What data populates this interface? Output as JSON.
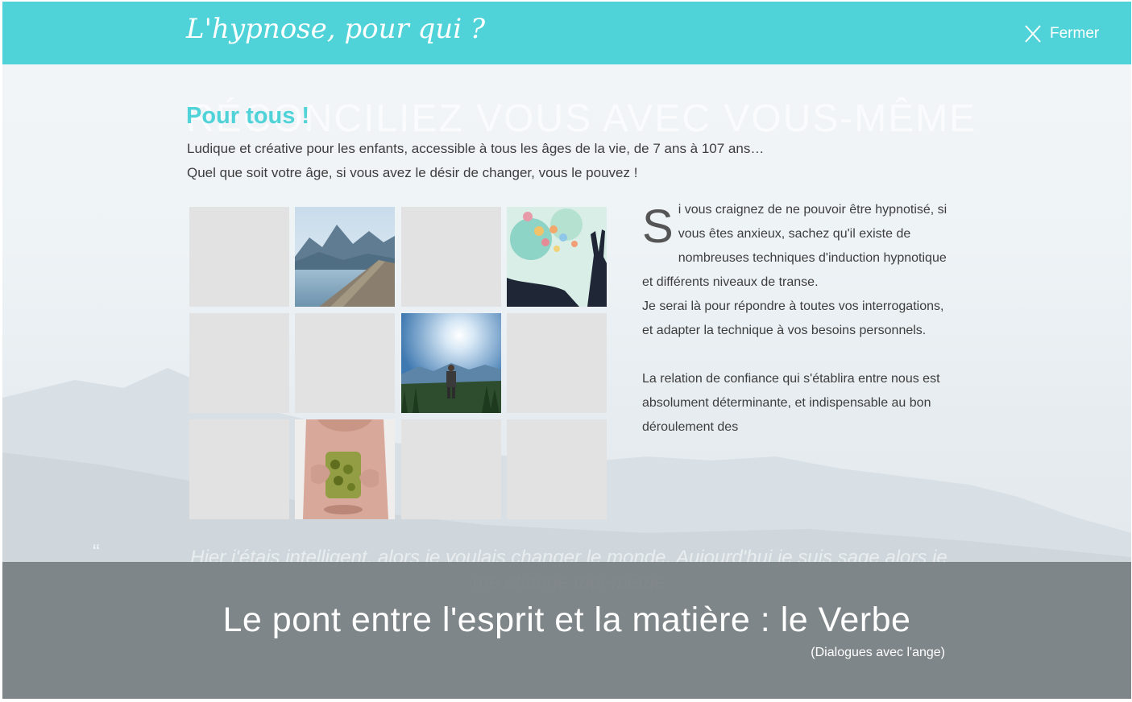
{
  "header": {
    "title": "L'hypnose, pour qui ?",
    "close_label": "Fermer",
    "accent_color": "#4fd3d8"
  },
  "background": {
    "heading": "RÉCONCILIEZ VOUS AVEC VOUS-MÊME",
    "quote": "Hier j'étais intelligent, alors je voulais changer le monde. Aujourd'hui je suis sage alors je me change moi-même"
  },
  "main": {
    "section_title": "Pour tous !",
    "intro_line_1": "Ludique et créative pour les enfants, accessible à tous les âges de la vie, de 7 ans à 107 ans…",
    "intro_line_2": "Quel que soit votre âge, si vous avez le désir de changer, vous le pouvez !",
    "gallery": [
      {
        "image": "blank"
      },
      {
        "image": "lake-pier-photo"
      },
      {
        "image": "blank"
      },
      {
        "image": "balloons-hands-photo"
      },
      {
        "image": "blank"
      },
      {
        "image": "blank"
      },
      {
        "image": "hiker-sun-mountains-photo"
      },
      {
        "image": "blank"
      },
      {
        "image": "blank"
      },
      {
        "image": "man-holding-jar-photo"
      },
      {
        "image": "blank"
      },
      {
        "image": "blank"
      }
    ],
    "drop_cap": "S",
    "paragraph_1_rest": "i vous craignez de ne pouvoir être hypnotisé, si vous êtes anxieux, sachez qu'il existe de nombreuses techniques d'induction hypnotique et différents niveaux de transe.",
    "paragraph_2": "Je serai là pour répondre à toutes vos interrogations, et adapter la technique à vos besoins personnels.",
    "paragraph_3": "La relation de confiance qui s'établira entre nous est absolument déterminante, et indispensable au bon déroulement des"
  },
  "footer": {
    "quote": "Le pont entre l'esprit et la matière : le Verbe",
    "source": "(Dialogues avec l'ange)"
  }
}
